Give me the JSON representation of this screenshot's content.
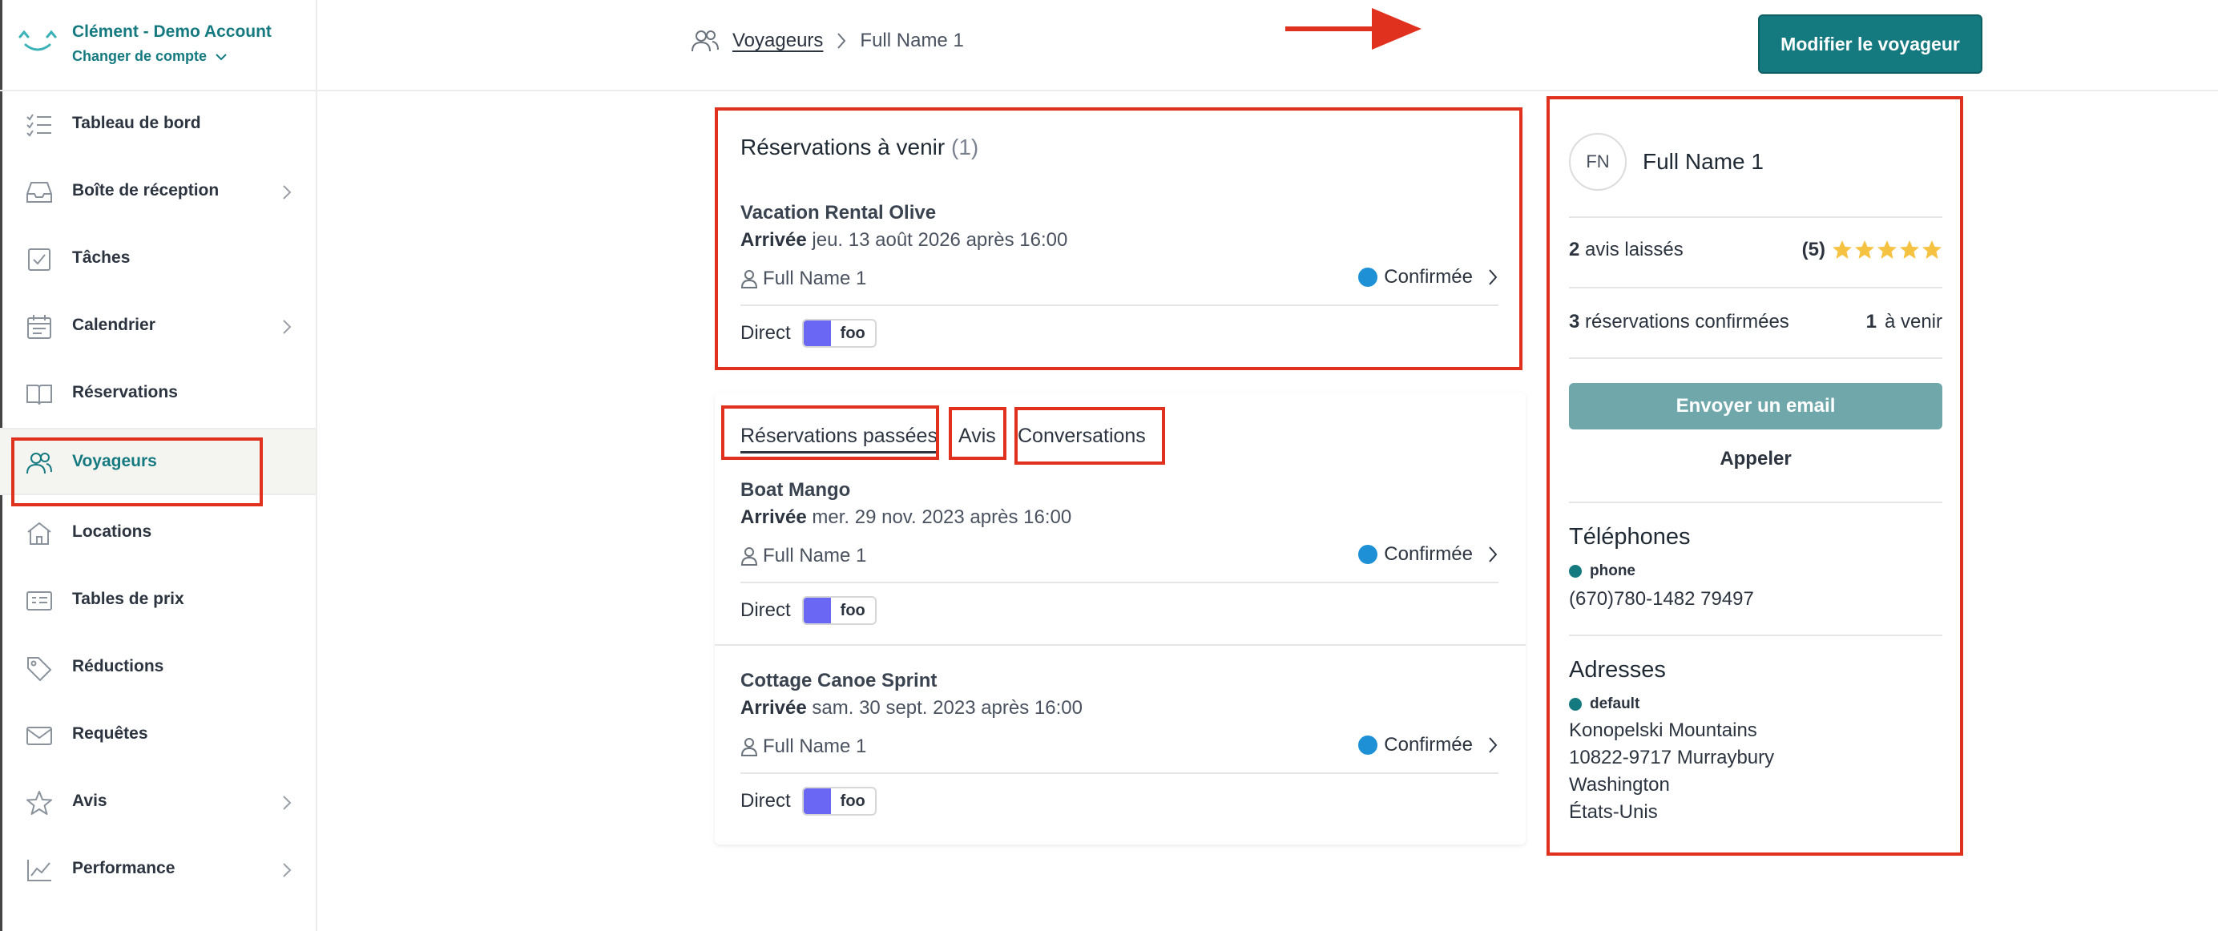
{
  "account": {
    "name": "Clément - Demo Account",
    "switch_label": "Changer de compte"
  },
  "sidebar": {
    "items": [
      {
        "label": "Tableau de bord",
        "icon": "dashboard-list-icon",
        "has_chevron": false
      },
      {
        "label": "Boîte de réception",
        "icon": "inbox-icon",
        "has_chevron": true
      },
      {
        "label": "Tâches",
        "icon": "task-check-icon",
        "has_chevron": false
      },
      {
        "label": "Calendrier",
        "icon": "calendar-icon",
        "has_chevron": true
      },
      {
        "label": "Réservations",
        "icon": "book-icon",
        "has_chevron": false
      },
      {
        "label": "Voyageurs",
        "icon": "users-icon",
        "has_chevron": false,
        "active": true
      },
      {
        "label": "Locations",
        "icon": "home-icon",
        "has_chevron": false
      },
      {
        "label": "Tables de prix",
        "icon": "price-table-icon",
        "has_chevron": false
      },
      {
        "label": "Réductions",
        "icon": "tag-icon",
        "has_chevron": false
      },
      {
        "label": "Requêtes",
        "icon": "mail-icon",
        "has_chevron": false
      },
      {
        "label": "Avis",
        "icon": "star-icon",
        "has_chevron": true
      },
      {
        "label": "Performance",
        "icon": "chart-line-icon",
        "has_chevron": true
      }
    ]
  },
  "breadcrumb": {
    "parent": "Voyageurs",
    "current": "Full Name 1"
  },
  "header": {
    "modify_button": "Modifier le voyageur"
  },
  "upcoming": {
    "title": "Réservations à venir",
    "count": "(1)",
    "reservations": [
      {
        "property": "Vacation Rental Olive",
        "arrival_label": "Arrivée",
        "arrival_date": "jeu. 13 août 2026 après 16:00",
        "guest": "Full Name 1",
        "status": "Confirmée",
        "channel": "Direct",
        "tag": "foo"
      }
    ]
  },
  "past": {
    "tabs": {
      "past": "Réservations passées",
      "reviews": "Avis",
      "conversations": "Conversations"
    },
    "reservations": [
      {
        "property": "Boat Mango",
        "arrival_label": "Arrivée",
        "arrival_date": "mer. 29 nov. 2023 après 16:00",
        "guest": "Full Name 1",
        "status": "Confirmée",
        "channel": "Direct",
        "tag": "foo"
      },
      {
        "property": "Cottage Canoe Sprint",
        "arrival_label": "Arrivée",
        "arrival_date": "sam. 30 sept. 2023 après 16:00",
        "guest": "Full Name 1",
        "status": "Confirmée",
        "channel": "Direct",
        "tag": "foo"
      }
    ]
  },
  "profile": {
    "initials": "FN",
    "name": "Full Name 1",
    "reviews_count": "2",
    "reviews_label": "avis laissés",
    "rating": "(5)",
    "stars": 5,
    "confirmed_count": "3",
    "confirmed_label": "réservations confirmées",
    "upcoming_count": "1",
    "upcoming_label": "à venir",
    "email_button": "Envoyer un email",
    "call_button": "Appeler",
    "phones_title": "Téléphones",
    "phone_kind": "phone",
    "phone_value": "(670)780-1482 79497",
    "addresses_title": "Adresses",
    "address_kind": "default",
    "address_lines": [
      "Konopelski Mountains",
      "10822-9717 Murraybury",
      "Washington",
      "États-Unis"
    ]
  },
  "colors": {
    "brand": "#157a80",
    "status_confirmed": "#1e90d6",
    "tag": "#6b67f5",
    "annotation": "#e0301e",
    "star": "#f5c242"
  }
}
